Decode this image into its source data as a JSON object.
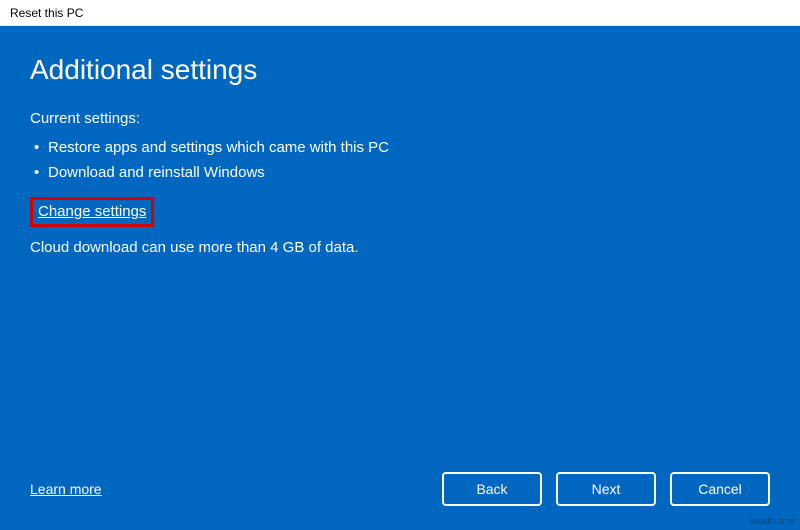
{
  "window": {
    "title": "Reset this PC"
  },
  "main": {
    "heading": "Additional settings",
    "current_settings_label": "Current settings:",
    "bullets": [
      "Restore apps and settings which came with this PC",
      "Download and reinstall Windows"
    ],
    "change_settings_link": "Change settings",
    "cloud_note": "Cloud download can use more than 4 GB of data."
  },
  "footer": {
    "learn_more": "Learn more",
    "buttons": {
      "back": "Back",
      "next": "Next",
      "cancel": "Cancel"
    }
  },
  "watermark": "wsxdn.com"
}
